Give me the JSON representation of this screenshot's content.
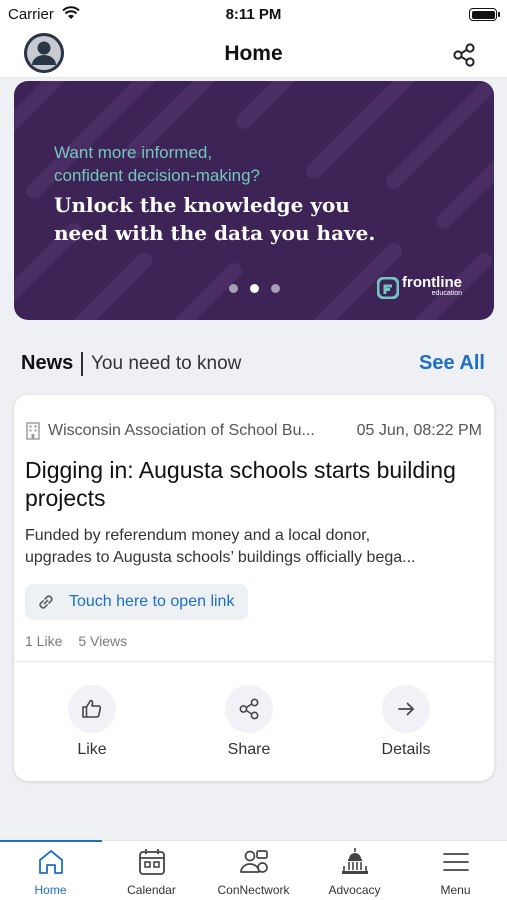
{
  "status_bar": {
    "carrier": "Carrier",
    "time": "8:11 PM"
  },
  "header": {
    "title": "Home"
  },
  "banner": {
    "question_line1": "Want more informed,",
    "question_line2": "confident decision-making?",
    "headline_line1": "Unlock the knowledge you",
    "headline_line2": "need with the data you have.",
    "brand_name": "frontline",
    "brand_sub": "education",
    "slide_count": 3,
    "active_slide": 2
  },
  "news": {
    "title": "News",
    "subtitle": "You need to know",
    "see_all": "See All"
  },
  "card": {
    "source": "Wisconsin Association of School Bu...",
    "date": "05 Jun, 08:22 PM",
    "title": "Digging in: Augusta schools starts building projects",
    "body_line1": "Funded by referendum money and a local donor,",
    "body_line2": "upgrades to Augusta schools’ buildings officially bega...",
    "link_label": "Touch here to open link",
    "likes": "1 Like",
    "views": "5 Views",
    "actions": {
      "like": "Like",
      "share": "Share",
      "details": "Details"
    }
  },
  "tabs": [
    {
      "label": "Home",
      "active": true
    },
    {
      "label": "Calendar",
      "active": false
    },
    {
      "label": "ConNectwork",
      "active": false
    },
    {
      "label": "Advocacy",
      "active": false
    },
    {
      "label": "Menu",
      "active": false
    }
  ],
  "colors": {
    "accent": "#1d6fc4",
    "banner_bg": "#3e2456",
    "banner_teal": "#73c6c0"
  }
}
